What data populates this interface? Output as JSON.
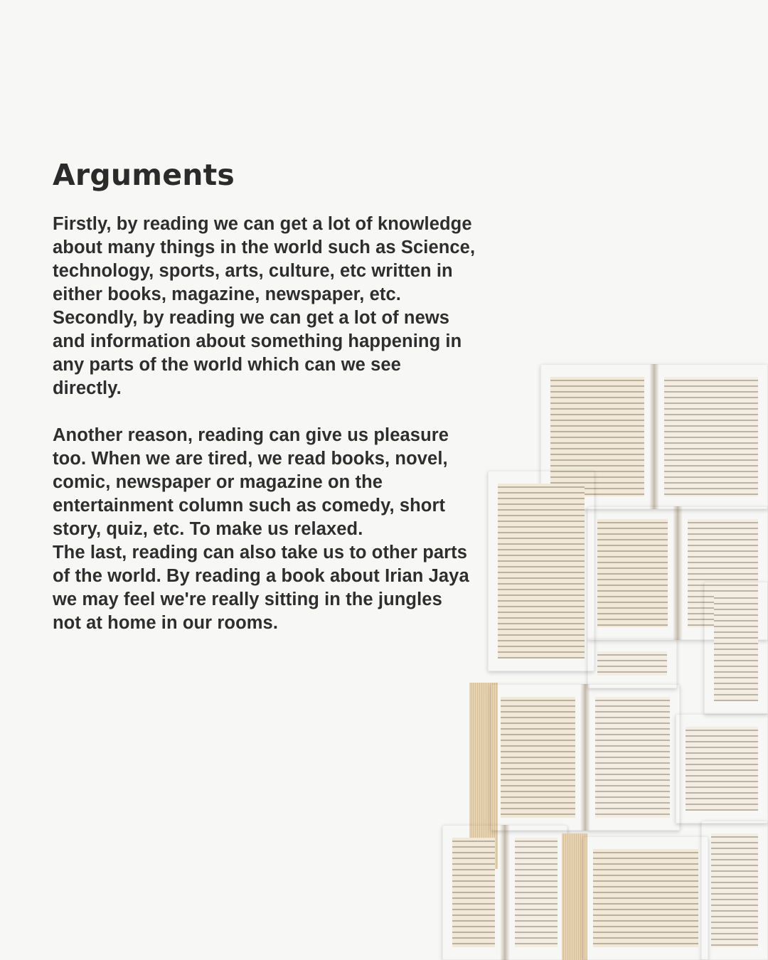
{
  "heading": "Arguments",
  "paragraph_1": [
    "Firstly, by reading we can get a lot of knowledge",
    "about many things in the world such as Science,",
    "technology, sports, arts, culture, etc written in",
    "either books, magazine, newspaper, etc.",
    "Secondly, by reading we can get a lot of news",
    "and information about something happening in",
    "any parts of the world which can we see",
    "directly."
  ],
  "paragraph_2": [
    "Another reason, reading can give us pleasure",
    "too. When we are tired, we read books, novel,",
    "comic, newspaper or magazine on the",
    "entertainment column such as comedy, short",
    "story, quiz, etc. To make us relaxed.",
    "The last, reading can also take us to other parts",
    "of the world. By reading a book about Irian Jaya",
    "we may feel we're really sitting in the jungles",
    "not at home in our rooms."
  ],
  "colors": {
    "background": "#f7f7f6",
    "text": "#2e2e2e",
    "page_paper": "#f3ede2",
    "page_edge": "#d9bf95"
  }
}
